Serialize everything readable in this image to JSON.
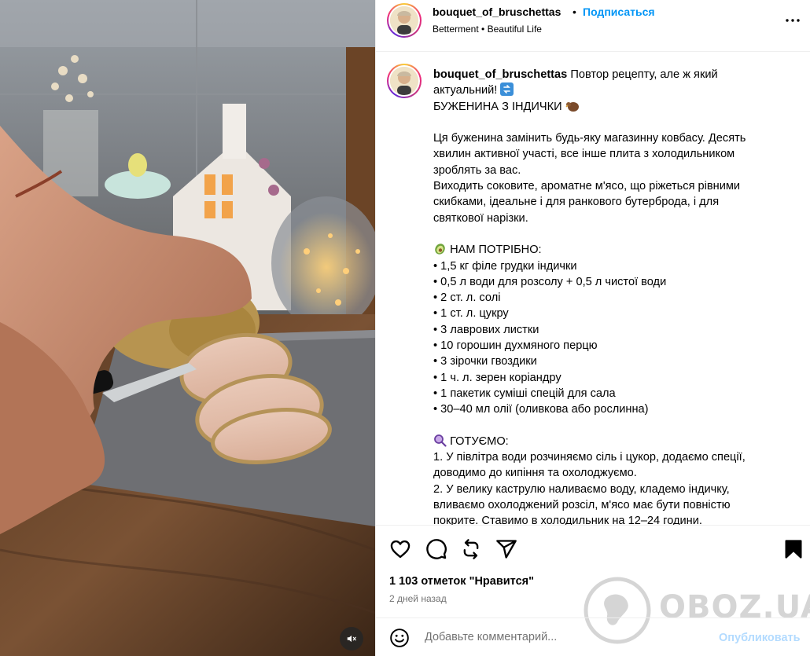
{
  "header": {
    "username": "bouquet_of_bruschettas",
    "separator": "•",
    "follow_label": "Подписаться",
    "audio_artist": "Betterment",
    "audio_track": "Beautiful Life",
    "more_icon": "more-horizontal-icon"
  },
  "caption": {
    "username": "bouquet_of_bruschettas",
    "lines": [
      "Повтор рецепту, але ж який",
      "актуальний!",
      "БУЖЕНИНА З ІНДИЧКИ",
      "",
      "Ця буженина замінить будь-яку магазинну ковбасу. Десять",
      "хвилин активної участі, все інше плита з холодильником",
      "зроблять за вас.",
      "Виходить соковите, ароматне м'ясо, що ріжеться рівними",
      "скибками, ідеальне і для ранкового бутерброда, і для",
      "святкової нарізки.",
      "",
      "НАМ ПОТРІБНО:",
      "• 1,5 кг філе грудки індички",
      "• 0,5 л води для розсолу + 0,5 л чистої води",
      "• 2 ст. л. солі",
      "• 1 ст. л. цукру",
      "• 3 лаврових листки",
      "• 10 горошин духмяного перцю",
      "• 3 зірочки гвоздики",
      "• 1 ч. л. зерен коріандру",
      "• 1 пакетик суміші спецій для сала",
      "• 30–40 мл олії (оливкова або рослинна)",
      "",
      "ГОТУЄМО:",
      "1. У півлітра води розчиняємо сіль і цукор, додаємо спеції,",
      "доводимо до кипіння та охолоджуємо.",
      "2. У велику каструлю наливаємо воду, кладемо індичку,",
      "вливаємо охолоджений розсіл, м'ясо має бути повністю",
      "покрите. Ставимо в холодильник на 12–24 години."
    ],
    "emoji_icons": [
      "repeat-arrow-emoji-icon",
      "turkey-emoji-icon",
      "avocado-emoji-icon",
      "magnifier-emoji-icon"
    ]
  },
  "actions": {
    "icons": [
      "heart-icon",
      "comment-icon",
      "repost-icon",
      "share-icon",
      "bookmark-icon"
    ]
  },
  "likes_text": "1 103 отметок \"Нравится\"",
  "time_text": "2 дней назад",
  "comment": {
    "placeholder": "Добавьте комментарий...",
    "post_label": "Опубликовать",
    "emoji_icon": "emoji-smile-icon"
  },
  "watermark": {
    "text": "OBOZ.UA"
  },
  "media": {
    "mute_icon": "speaker-muted-icon"
  },
  "colors": {
    "link_blue": "#0095f6",
    "post_button_disabled": "#b3dbff",
    "secondary_text": "#737373",
    "divider": "#efefef"
  }
}
